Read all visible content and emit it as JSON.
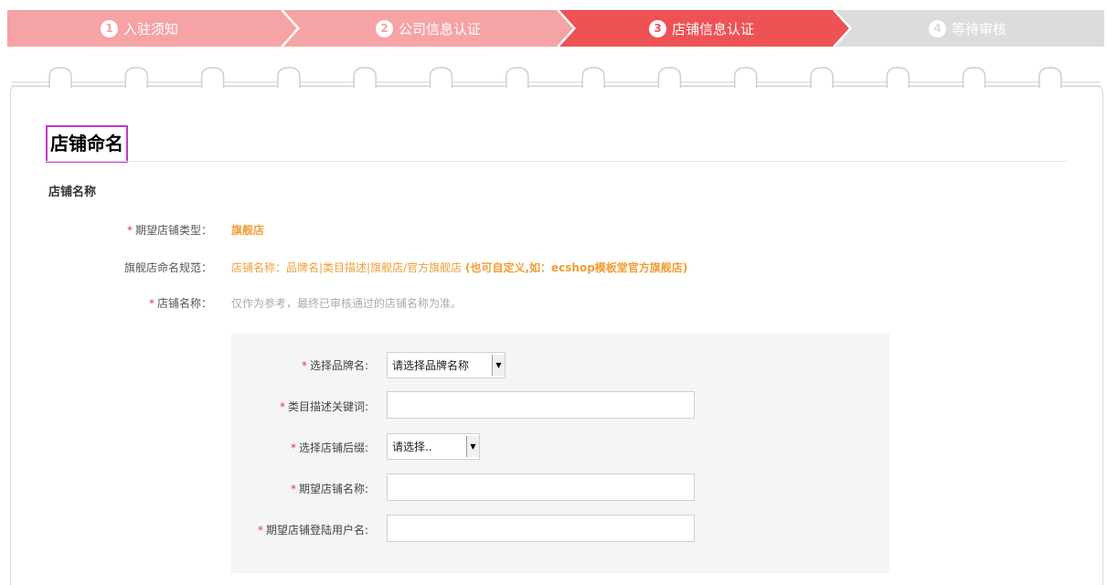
{
  "steps": [
    {
      "num": "1",
      "label": "入驻须知",
      "state": "done",
      "color": "#f5a3a5"
    },
    {
      "num": "2",
      "label": "公司信息认证",
      "state": "done",
      "color": "#f5a3a5"
    },
    {
      "num": "3",
      "label": "店铺信息认证",
      "state": "active",
      "color": "#ee5255"
    },
    {
      "num": "4",
      "label": "等待审核",
      "state": "pending",
      "color": "#dcdcdc"
    }
  ],
  "section": {
    "title": "店铺命名",
    "subtitle": "店铺名称"
  },
  "fields": {
    "shop_type": {
      "label": "期望店铺类型：",
      "value": "旗舰店"
    },
    "naming_rule": {
      "label": "旗舰店命名规范：",
      "value": "店铺名称：品牌名|类目描述|旗舰店/官方旗舰店",
      "note": "(也可自定义,如：ecshop模板堂官方旗舰店)"
    },
    "shop_name": {
      "label": "店铺名称：",
      "hint": "仅作为参考，最终已审核通过的店铺名称为准。"
    }
  },
  "form": {
    "brand": {
      "label": "选择品牌名:",
      "value": "请选择品牌名称"
    },
    "keyword": {
      "label": "类目描述关键词:",
      "value": ""
    },
    "suffix": {
      "label": "选择店铺后缀:",
      "value": "请选择.."
    },
    "expected_name": {
      "label": "期望店铺名称:",
      "value": ""
    },
    "login_user": {
      "label": "期望店铺登陆用户名:",
      "value": ""
    }
  },
  "required_mark": "*"
}
